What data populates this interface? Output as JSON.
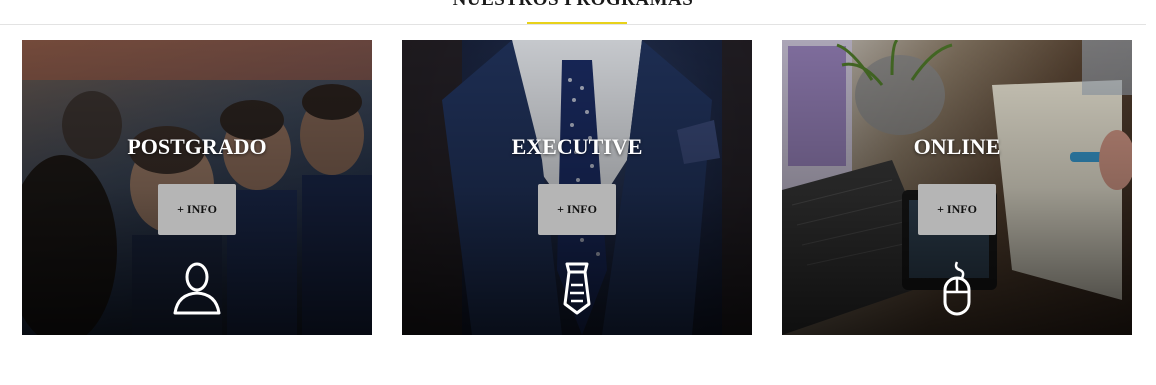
{
  "section": {
    "title": "NUESTROS PROGRAMAS",
    "accent_color": "#e8d21a"
  },
  "cards": [
    {
      "title": "POSTGRADO",
      "button_label": "+ INFO",
      "icon": "person-icon"
    },
    {
      "title": "EXECUTIVE",
      "button_label": "+ INFO",
      "icon": "tie-icon"
    },
    {
      "title": "ONLINE",
      "button_label": "+ INFO",
      "icon": "mouse-icon"
    }
  ]
}
